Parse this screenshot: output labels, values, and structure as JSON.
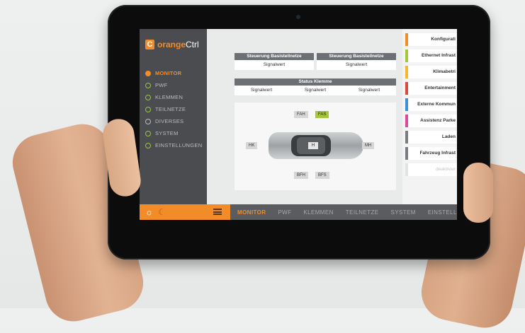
{
  "app": {
    "logo_letter": "C",
    "logo_brand": "orange",
    "logo_suffix": "Ctrl"
  },
  "sidebar": {
    "items": [
      {
        "label": "MONITOR",
        "state": "active"
      },
      {
        "label": "PWF",
        "state": "checked"
      },
      {
        "label": "KLEMMEN",
        "state": "checked"
      },
      {
        "label": "TEILNETZE",
        "state": "checked"
      },
      {
        "label": "DIVERSES",
        "state": "unchecked"
      },
      {
        "label": "SYSTEM",
        "state": "checked"
      },
      {
        "label": "EINSTELLUNGEN",
        "state": "checked"
      }
    ]
  },
  "main": {
    "steuerung1": {
      "title": "Steuerung Basisteilnetze",
      "value": "Signalwert"
    },
    "steuerung2": {
      "title": "Steuerung Basisteilnetze",
      "value": "Signalwert"
    },
    "klemme": {
      "title": "Status Klemme",
      "values": [
        "Signalwert",
        "Signalwert",
        "Signalwert"
      ]
    },
    "seats": {
      "fah": "FAH",
      "fas": "FAS",
      "hk": "HK",
      "h": "H",
      "mh": "MH",
      "bfh": "BFH",
      "bfs": "BFS"
    }
  },
  "right_list": {
    "items": [
      {
        "label": "Konfigurati",
        "color": "#f28c28",
        "disabled": false
      },
      {
        "label": "Ethernet Infrast",
        "color": "#a4c639",
        "disabled": false
      },
      {
        "label": "Klimabetri",
        "color": "#f5b82e",
        "disabled": false
      },
      {
        "label": "Entertainment",
        "color": "#d84a3e",
        "disabled": false
      },
      {
        "label": "Externe Kommun",
        "color": "#3a8fd6",
        "disabled": false
      },
      {
        "label": "Assistenz Parke",
        "color": "#d94b9a",
        "disabled": false
      },
      {
        "label": "Laden",
        "color": "#7a7d80",
        "disabled": false
      },
      {
        "label": "Fahrzeug Infrast",
        "color": "#7a7d80",
        "disabled": false
      },
      {
        "label": "deaktivier",
        "color": "#e3e3e3",
        "disabled": true
      }
    ]
  },
  "bottom_bar": {
    "tabs": [
      "MONITOR",
      "PWF",
      "KLEMMEN",
      "TEILNETZE",
      "SYSTEM",
      "EINSTELLUNGEN"
    ],
    "active_tab": "MONITOR",
    "accent": "#f28c28"
  }
}
